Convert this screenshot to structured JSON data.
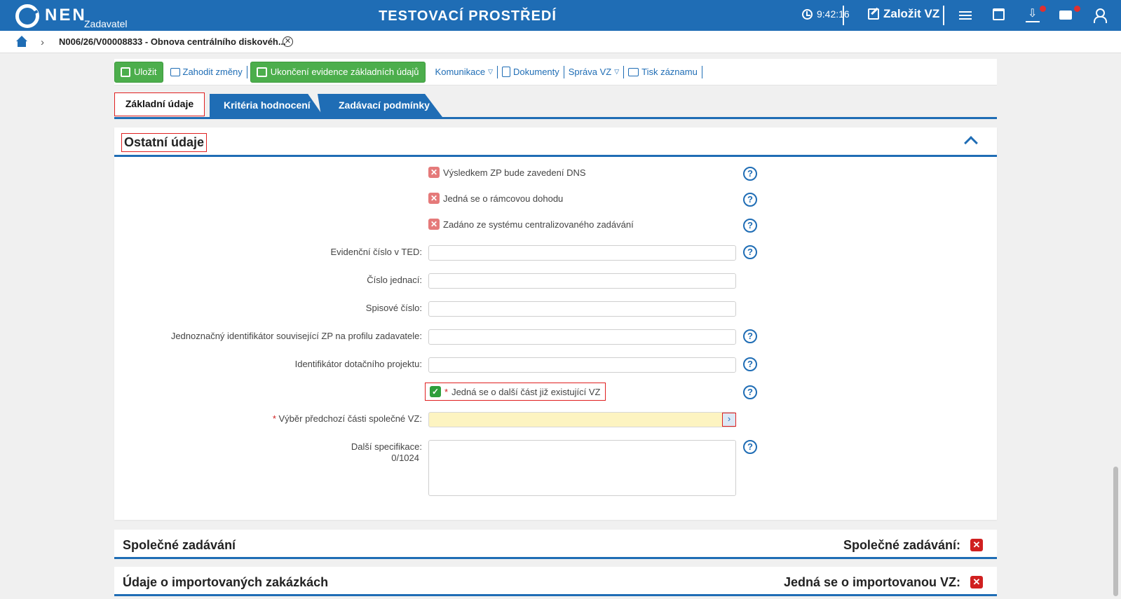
{
  "header": {
    "logo_text": "NEN",
    "logo_sub": "Zadavatel",
    "env_title": "TESTOVACÍ PROSTŘEDÍ",
    "time": "9:42:16",
    "new_vz": "Založit VZ"
  },
  "breadcrumb": {
    "text": "N006/26/V00008833 - Obnova centrálního diskovéh..."
  },
  "toolbar": {
    "save": "Uložit",
    "discard": "Zahodit změny",
    "finish": "Ukončení evidence základních údajů",
    "communication": "Komunikace",
    "documents": "Dokumenty",
    "manage": "Správa VZ",
    "print": "Tisk záznamu"
  },
  "tabs": {
    "basic": "Základní údaje",
    "criteria": "Kritéria hodnocení",
    "conditions": "Zadávací podmínky"
  },
  "section": {
    "title": "Ostatní údaje",
    "checkbox_dns": "Výsledkem ZP bude zavedení DNS",
    "checkbox_framework": "Jedná se o rámcovou dohodu",
    "checkbox_central": "Zadáno ze systému centralizovaného zadávání",
    "ted_label": "Evidenční číslo v TED:",
    "ref_label": "Číslo jednací:",
    "file_label": "Spisové číslo:",
    "profile_id_label": "Jednoznačný identifikátor související ZP na profilu zadavatele:",
    "grant_label": "Identifikátor dotačního projektu:",
    "required_mark": "*",
    "checkbox_existing": "Jedná se o další část již existující VZ",
    "prev_part_label": "Výběr předchozí části společné VZ:",
    "spec_label": "Další specifikace:",
    "spec_counter": "0/1024"
  },
  "panels": {
    "joint_title": "Společné zadávání",
    "joint_right": "Společné zadávání:",
    "import_title": "Údaje o importovaných zakázkách",
    "import_right": "Jedná se o importovanou VZ:"
  },
  "colors": {
    "brand": "#1f6db5",
    "green": "#4cae4c",
    "required": "#d02020",
    "highlight_field": "#fdf4c1"
  }
}
